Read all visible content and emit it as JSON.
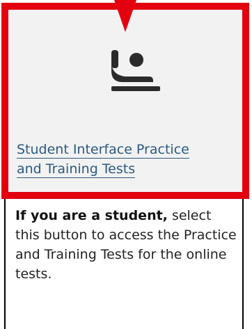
{
  "tile": {
    "icon": "student-raised-hand-icon",
    "link_line1": "Student Interface Practice",
    "link_line2": "and Training Tests"
  },
  "description": {
    "lead": "If you are a student,",
    "text": "select this button to access the Practice and Training Tests for the online tests."
  },
  "colors": {
    "highlight": "#e3000f",
    "link": "#2a5a82",
    "icon": "#2b2b2b",
    "tile_background": "#f2f2f2"
  }
}
